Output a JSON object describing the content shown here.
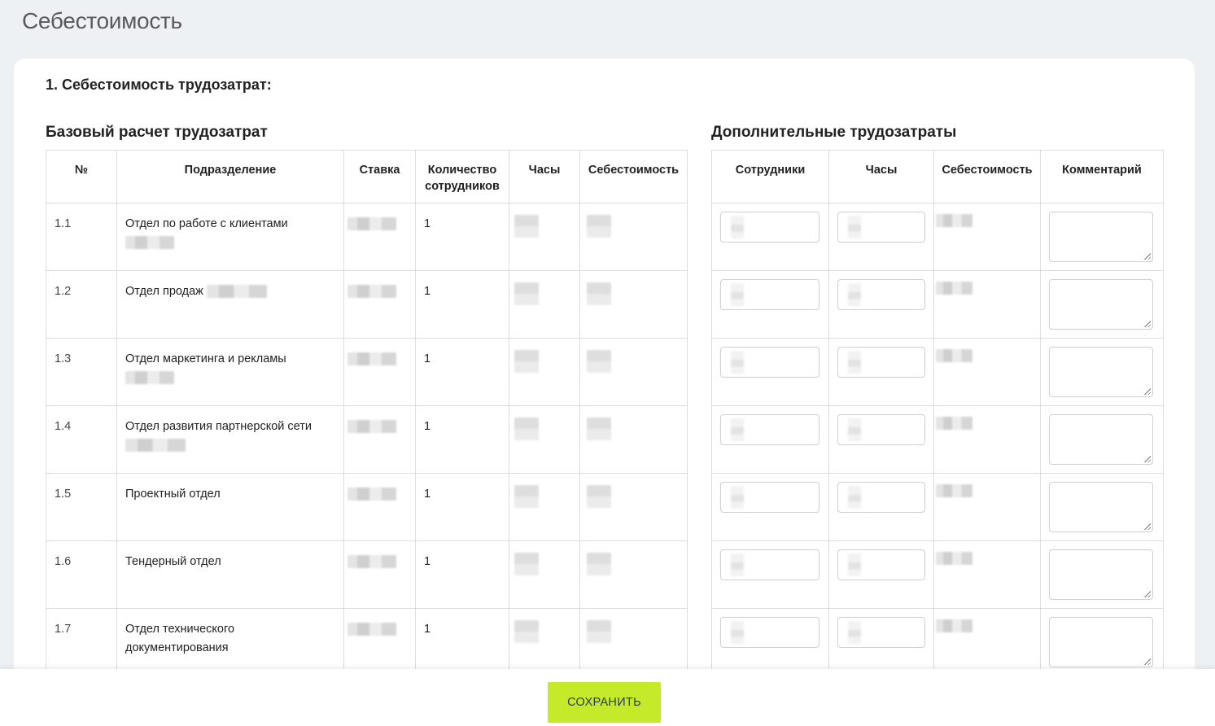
{
  "page": {
    "title": "Себестоимость"
  },
  "section": {
    "title": "1. Себестоимость трудозатрат:"
  },
  "base_table": {
    "title": "Базовый расчет трудозатрат",
    "headers": [
      "№",
      "Подразделение",
      "Ставка",
      "Количество сотрудников",
      "Часы",
      "Себестоимость"
    ],
    "rows": [
      {
        "num": "1.1",
        "department": "Отдел по работе с клиентами",
        "employees": "1"
      },
      {
        "num": "1.2",
        "department": "Отдел продаж",
        "employees": "1"
      },
      {
        "num": "1.3",
        "department": "Отдел маркетинга и рекламы",
        "employees": "1"
      },
      {
        "num": "1.4",
        "department": "Отдел развития партнерской сети",
        "employees": "1"
      },
      {
        "num": "1.5",
        "department": "Проектный отдел",
        "employees": "1"
      },
      {
        "num": "1.6",
        "department": "Тендерный отдел",
        "employees": "1"
      },
      {
        "num": "1.7",
        "department": "Отдел технического документирования",
        "employees": "1"
      }
    ]
  },
  "extra_table": {
    "title": "Дополнительные трудозатраты",
    "headers": [
      "Сотрудники",
      "Часы",
      "Себестоимость",
      "Комментарий"
    ],
    "row_count": 7
  },
  "footer": {
    "save_label": "СОХРАНИТЬ"
  },
  "colors": {
    "save_button": "#c5ea2a",
    "background": "#eef1f4",
    "card": "#ffffff"
  }
}
